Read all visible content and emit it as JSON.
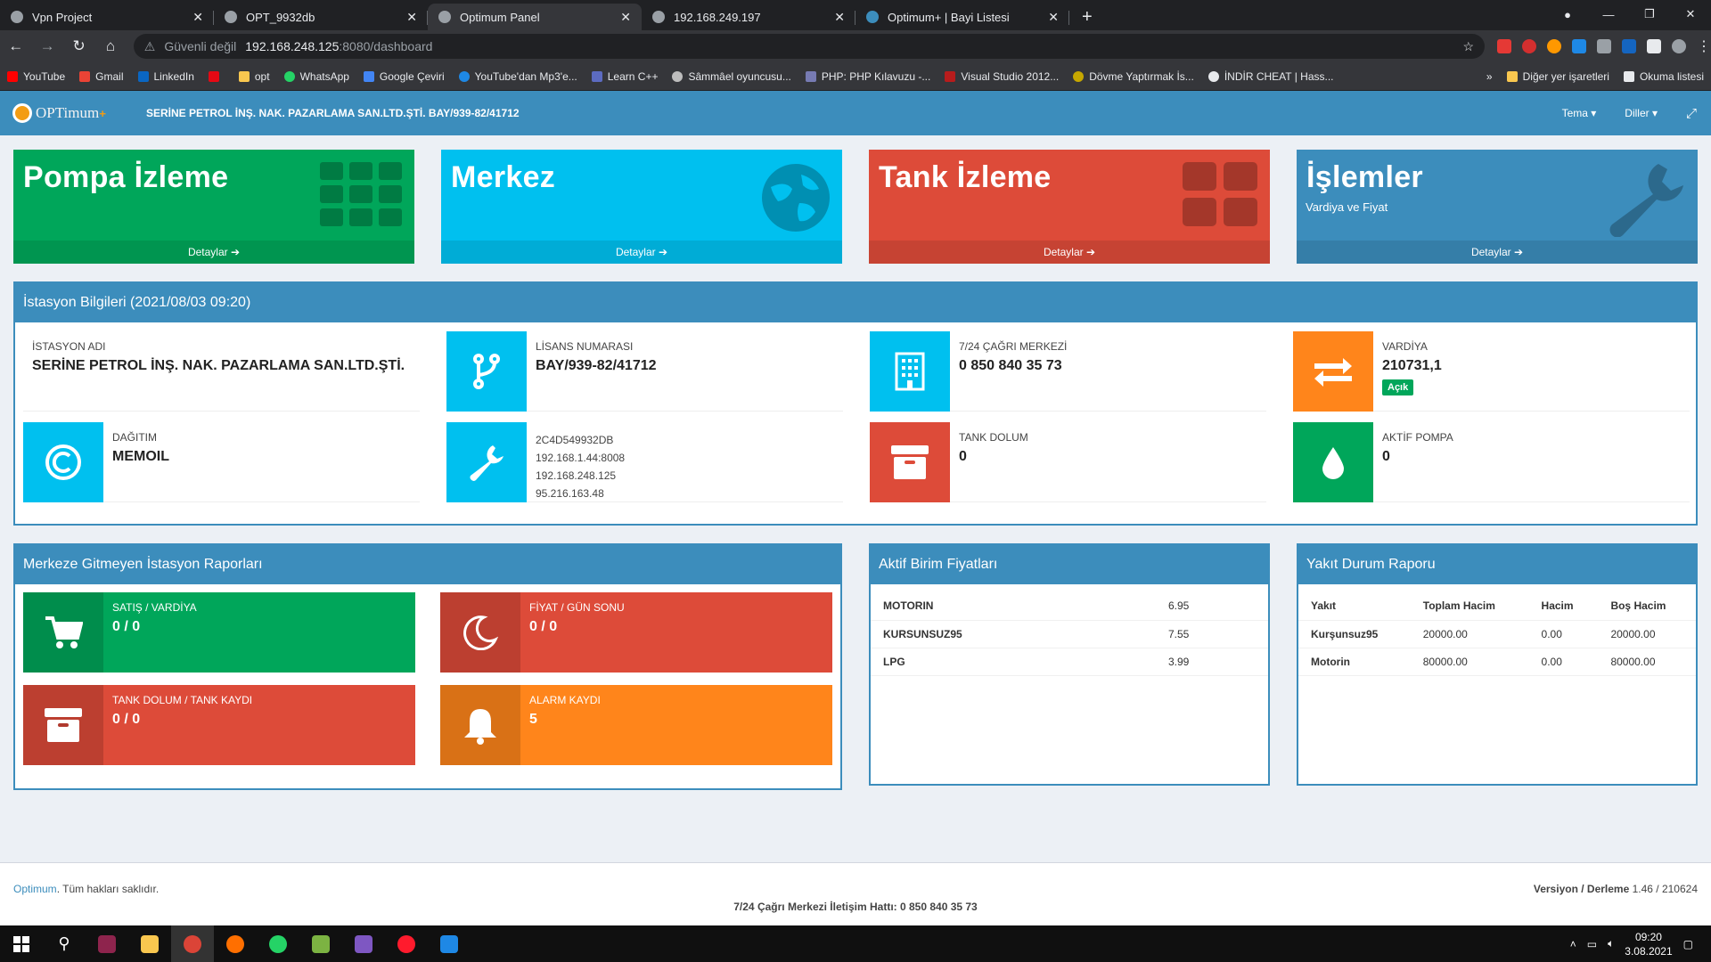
{
  "browser": {
    "tabs": [
      {
        "title": "Vpn Project",
        "active": false
      },
      {
        "title": "OPT_9932db",
        "active": false
      },
      {
        "title": "Optimum Panel",
        "active": true
      },
      {
        "title": "192.168.249.197",
        "active": false
      },
      {
        "title": "Optimum+ | Bayi Listesi",
        "active": false
      }
    ],
    "url_warning": "Güvenli değil",
    "url_host": "192.168.248.125",
    "url_path": ":8080/dashboard",
    "bookmarks": [
      "YouTube",
      "Gmail",
      "LinkedIn",
      "",
      "opt",
      "WhatsApp",
      "Google Çeviri",
      "YouTube'dan Mp3'e...",
      "Learn C++",
      "Sâmmâel oyuncusu...",
      "PHP: PHP Kılavuzu -...",
      "Visual Studio 2012...",
      "Dövme Yaptırmak İs...",
      "İNDİR CHEAT | Hass..."
    ],
    "bookmarks_more": "»",
    "other_bookmarks": "Diğer yer işaretleri",
    "reading_list": "Okuma listesi"
  },
  "header": {
    "logo": "OPTimum",
    "title": "SERİNE PETROL İNŞ. NAK. PAZARLAMA SAN.LTD.ŞTİ. BAY/939-82/41712",
    "theme": "Tema ▾",
    "languages": "Diller ▾"
  },
  "tiles": [
    {
      "title": "Pompa İzleme",
      "subtitle": "",
      "footer": "Detaylar ➔",
      "color": "#00a65a",
      "icon": "grid-icon"
    },
    {
      "title": "Merkez",
      "subtitle": "",
      "footer": "Detaylar ➔",
      "color": "#00c0ef",
      "icon": "globe-icon"
    },
    {
      "title": "Tank İzleme",
      "subtitle": "",
      "footer": "Detaylar ➔",
      "color": "#dd4b39",
      "icon": "tank-icon"
    },
    {
      "title": "İşlemler",
      "subtitle": "Vardiya ve Fiyat",
      "footer": "Detaylar ➔",
      "color": "#3c8dbc",
      "icon": "wrench-icon"
    }
  ],
  "station": {
    "header": "İstasyon Bilgileri (2021/08/03 09:20)",
    "name_label": "İSTASYON ADI",
    "name_value": "SERİNE PETROL İNŞ. NAK. PAZARLAMA SAN.LTD.ŞTİ.",
    "license_label": "LİSANS NUMARASI",
    "license_value": "BAY/939-82/41712",
    "callcenter_label": "7/24 ÇAĞRI MERKEZİ",
    "callcenter_value": "0 850 840 35 73",
    "shift_label": "VARDİYA",
    "shift_value": "210731,1",
    "shift_status": "Açık",
    "dist_label": "DAĞITIM",
    "dist_value": "MEMOIL",
    "device_id": "2C4D549932DB",
    "ip1": "192.168.1.44:8008",
    "ip2": "192.168.248.125",
    "ip3": "95.216.163.48",
    "tank_label": "TANK DOLUM",
    "tank_value": "0",
    "pump_label": "AKTİF POMPA",
    "pump_value": "0"
  },
  "reports": {
    "header": "Merkeze Gitmeyen İstasyon Raporları",
    "items": [
      {
        "label": "SATIŞ / VARDİYA",
        "value": "0 / 0"
      },
      {
        "label": "FİYAT / GÜN SONU",
        "value": "0 / 0"
      },
      {
        "label": "TANK DOLUM / TANK KAYDI",
        "value": "0 / 0"
      },
      {
        "label": "ALARM KAYDI",
        "value": "5"
      }
    ]
  },
  "prices": {
    "header": "Aktif Birim Fiyatları",
    "rows": [
      [
        "MOTORIN",
        "6.95"
      ],
      [
        "KURSUNSUZ95",
        "7.55"
      ],
      [
        "LPG",
        "3.99"
      ]
    ]
  },
  "fuel": {
    "header": "Yakıt Durum Raporu",
    "columns": [
      "Yakıt",
      "Toplam Hacim",
      "Hacim",
      "Boş Hacim"
    ],
    "rows": [
      [
        "Kurşunsuz95",
        "20000.00",
        "0.00",
        "20000.00"
      ],
      [
        "Motorin",
        "80000.00",
        "0.00",
        "80000.00"
      ]
    ]
  },
  "footer": {
    "brand": "Optimum",
    "rights": ". Tüm hakları saklıdır.",
    "version_label": "Versiyon / Derleme",
    "version_value": " 1.46 / 210624",
    "hotline": "7/24 Çağrı Merkezi İletişim Hattı: 0 850 840 35 73"
  },
  "taskbar": {
    "time": "09:20",
    "date": "3.08.2021"
  }
}
